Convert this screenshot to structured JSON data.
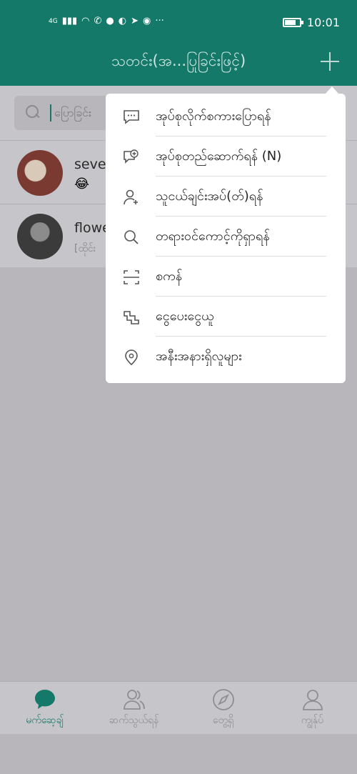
{
  "status_bar": {
    "signal_label": "4G",
    "time": "10:01"
  },
  "header": {
    "title": "သတင်း(အ...ပြုခြင်းဖြင့်)",
    "plus_icon": "plus-icon"
  },
  "search": {
    "placeholder": "ပြောခြင်း"
  },
  "chats": [
    {
      "name": "seve",
      "preview_emoji": "😂"
    },
    {
      "name": "flowe",
      "preview": "[ထိုင်း"
    }
  ],
  "popup_menu": {
    "items": [
      {
        "label": "အုပ်စုလိုက်စကားပြောရန်",
        "icon": "chat-bubble-icon"
      },
      {
        "label": "အုပ်စုတည်ဆောက်ရန် (N)",
        "icon": "add-group-icon"
      },
      {
        "label": "သူငယ်ချင်းအပ်(တ်)ရန်",
        "icon": "add-friend-icon"
      },
      {
        "label": "တရားဝင်ကောင့်ကိုရှာရန်",
        "icon": "search-icon"
      },
      {
        "label": "စကန်",
        "icon": "scan-icon"
      },
      {
        "label": "ငွေပေးငွေယူ",
        "icon": "payment-icon"
      },
      {
        "label": "အနီးအနားရှိလူများ",
        "icon": "location-icon"
      }
    ]
  },
  "bottom_nav": [
    {
      "label": "မက်ဆေ့ချ်",
      "icon": "chat-icon",
      "active": true
    },
    {
      "label": "ဆက်သွယ်ရန်",
      "icon": "contacts-icon",
      "active": false
    },
    {
      "label": "တွေ့ရှိ",
      "icon": "compass-icon",
      "active": false
    },
    {
      "label": "ကျွန်ုပ်",
      "icon": "profile-icon",
      "active": false
    }
  ],
  "colors": {
    "brand": "#15796a",
    "overlay": "#b8b6bb"
  }
}
